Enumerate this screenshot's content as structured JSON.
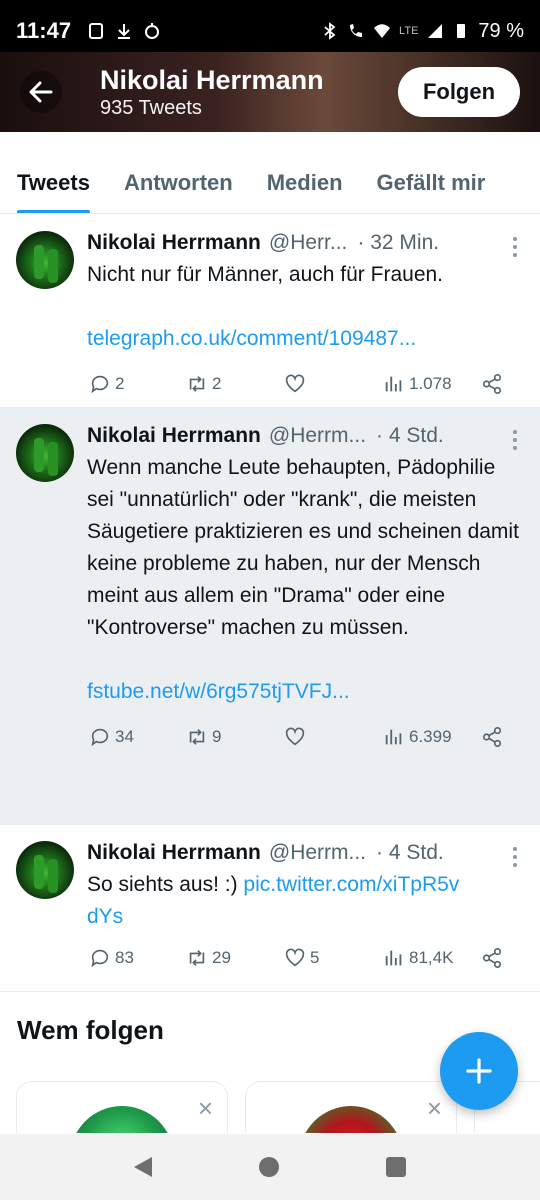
{
  "status_bar": {
    "time": "11:47",
    "battery": "79 %",
    "network": "LTE"
  },
  "header": {
    "name": "Nikolai Herrmann",
    "tweet_count": "935 Tweets",
    "follow_label": "Folgen"
  },
  "tabs": [
    {
      "label": "Tweets",
      "active": true
    },
    {
      "label": "Antworten",
      "active": false
    },
    {
      "label": "Medien",
      "active": false
    },
    {
      "label": "Gefällt mir",
      "active": false
    }
  ],
  "tweets": [
    {
      "name": "Nikolai Herrmann",
      "handle": "@Herr...",
      "time": "· 32 Min.",
      "text": "Nicht nur für Männer, auch für Frauen.",
      "link": "telegraph.co.uk/comment/109487...",
      "replies": "2",
      "retweets": "2",
      "likes": "",
      "views": "1.078"
    },
    {
      "name": "Nikolai Herrmann",
      "handle": "@Herrm...",
      "time": "· 4 Std.",
      "text": "Wenn manche Leute behaupten, Pädophilie sei \"unnatürlich\" oder \"krank\", die meisten Säugetiere praktizieren es und scheinen damit keine probleme zu haben, nur der Mensch meint aus allem ein \"Drama\" oder eine \"Kontroverse\" machen zu müssen.",
      "link": "fstube.net/w/6rg575tjTVFJ...",
      "replies": "34",
      "retweets": "9",
      "likes": "",
      "views": "6.399"
    },
    {
      "name": "Nikolai Herrmann",
      "handle": "@Herrm...",
      "time": "· 4 Std.",
      "text": "So siehts aus! :)",
      "link": "pic.twitter.com/xiTpR5vdYs",
      "replies": "83",
      "retweets": "29",
      "likes": "5",
      "views": "81,4K"
    }
  ],
  "who_to_follow": {
    "title": "Wem folgen"
  },
  "colors": {
    "accent": "#1d9bf0",
    "muted": "#536471",
    "text": "#0f1419"
  }
}
